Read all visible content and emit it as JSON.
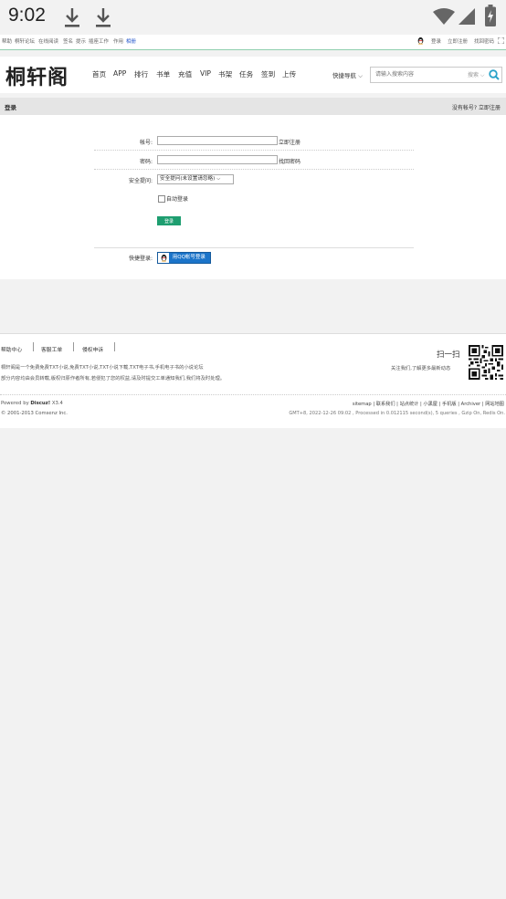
{
  "status_bar": {
    "time": "9:02"
  },
  "topbar": {
    "left_links": [
      "帮助",
      "桐轩论坛",
      "在线阅读",
      "签名",
      "提示",
      "插座工作",
      "作用",
      "相册"
    ],
    "right_links": [
      "登录",
      "立即注册",
      "找回密码"
    ]
  },
  "header": {
    "logo": "桐轩阁",
    "nav": [
      "首页",
      "APP",
      "排行",
      "书单",
      "充值",
      "VIP",
      "书架",
      "任务",
      "签到",
      "上传"
    ],
    "quick_nav": "快捷导航",
    "search_placeholder": "请输入搜索内容",
    "search_category": "搜索"
  },
  "title_bar": {
    "title": "登录",
    "right_text": "没有帐号? 立即注册"
  },
  "login_form": {
    "username_label": "帐号:",
    "username_link": "立即注册",
    "password_label": "密码:",
    "password_link": "找回密码",
    "question_label": "安全提问:",
    "question_value": "安全提问(未设置请忽略)",
    "auto_login": "自动登录",
    "submit": "登录",
    "quick_login_label": "快捷登录:",
    "qq_login": "用QQ帐号登录"
  },
  "footer": {
    "links": [
      "帮助中心",
      "客服工单",
      "侵权申诉"
    ],
    "desc1": "桐轩阁是一个免费免费TXT小说,免费TXT小说,TXT小说下载,TXT电子书,手机电子书的小说论坛",
    "desc2": "部分内容均由会员转载,版权归原作者所有,若侵犯了您的权益,请及时提交工单通知我们,我们将及时处理。",
    "follow_text": "关注我们,了解更多最新动态",
    "scan_text": "扫一扫",
    "powered_prefix": "Powered by",
    "powered_name": "Discuz!",
    "powered_version": "X3.4",
    "copyright": "© 2001-2013 Comsenz Inc.",
    "bottom_links": [
      "sitemap",
      "联系我们",
      "站点统计",
      "小黑屋",
      "手机版",
      "Archiver",
      "网站地图"
    ],
    "processed": "GMT+8, 2022-12-26 09:02 , Processed in 0.012115 second(s), 5 queries , Gzip On, Redis On."
  }
}
